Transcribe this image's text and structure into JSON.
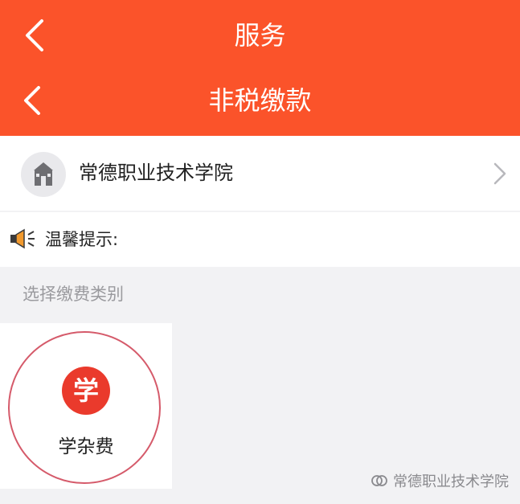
{
  "header": {
    "parent_title": "服务",
    "title": "非税缴款"
  },
  "school": {
    "name": "常德职业技术学院",
    "avatar_icon": "school-building-icon",
    "chevron_icon": "chevron-right-icon"
  },
  "tip": {
    "icon": "speaker-icon",
    "label": "温馨提示:"
  },
  "section": {
    "label": "选择缴费类别"
  },
  "fee_items": [
    {
      "badge": "学",
      "label": "学杂费"
    }
  ],
  "watermark": {
    "text": "常德职业技术学院",
    "icon": "wechat-channel-icon"
  },
  "colors": {
    "header_bg": "#fb532a",
    "badge_bg": "#ea3a2c",
    "ring": "#d55a6a"
  }
}
